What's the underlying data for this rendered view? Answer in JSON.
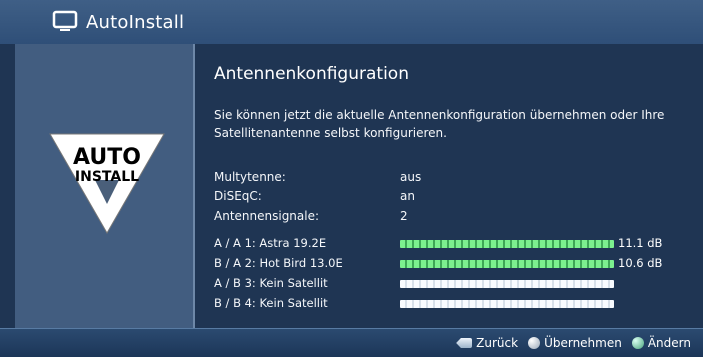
{
  "window": {
    "title": "AutoInstall"
  },
  "sidebar": {
    "logo_line1": "AUTO",
    "logo_line2": "INSTALL"
  },
  "content": {
    "heading": "Antennenkonfiguration",
    "description": "Sie können jetzt die aktuelle Antennenkonfiguration übernehmen oder Ihre Satellitenantenne selbst konfigurieren.",
    "settings": [
      {
        "label": "Multytenne:",
        "value": "aus"
      },
      {
        "label": "DiSEqC:",
        "value": "an"
      },
      {
        "label": "Antennensignale:",
        "value": "2"
      }
    ],
    "satellites": [
      {
        "label": "A / A  1:  Astra 19.2E",
        "signal_fraction": 1.0,
        "db": "11.1 dB"
      },
      {
        "label": "B / A  2:  Hot Bird 13.0E",
        "signal_fraction": 1.0,
        "db": "10.6 dB"
      },
      {
        "label": "A / B  3:  Kein Satellit",
        "signal_fraction": 0.0,
        "db": ""
      },
      {
        "label": "B / B  4:  Kein Satellit",
        "signal_fraction": 0.0,
        "db": ""
      }
    ]
  },
  "footer": {
    "back_label": "Zurück",
    "accept_label": "Übernehmen",
    "change_label": "Ändern"
  },
  "colors": {
    "content_bg": "#1f3553",
    "sidebar_bg": "#425d80",
    "signal_green": "#7cf08f"
  },
  "icons": {
    "title_icon": "tv-icon",
    "back_icon": "back-icon",
    "accept_icon": "ok-icon",
    "change_icon": "green-button-icon"
  }
}
